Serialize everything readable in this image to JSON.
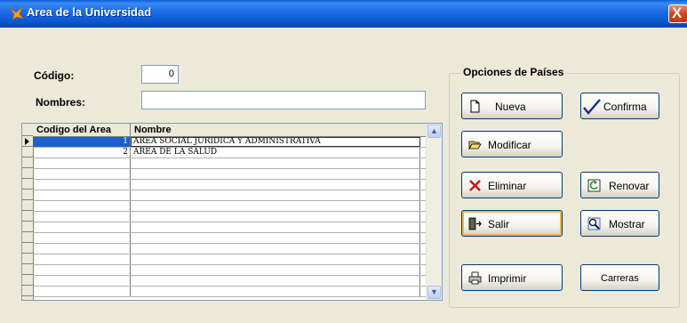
{
  "window": {
    "title": "Area de la Universidad",
    "close_glyph": "X"
  },
  "form": {
    "codigo_label": "Código:",
    "codigo_value": "0",
    "nombres_label": "Nombres:",
    "nombres_value": ""
  },
  "grid": {
    "columns": [
      "Codigo del Area",
      "Nombre"
    ],
    "rows": [
      {
        "codigo": "1",
        "nombre": "AREA SOCIAL JURIDICA Y ADMINISTRATIVA"
      },
      {
        "codigo": "2",
        "nombre": "AREA DE LA SALUD"
      }
    ],
    "scroll_up_glyph": "▲",
    "scroll_down_glyph": "▼"
  },
  "options": {
    "title": "Opciones de Países",
    "nueva": "Nueva",
    "confirma": "Confirma",
    "modificar": "Modificar",
    "eliminar": "Eliminar",
    "renovar": "Renovar",
    "salir": "Salir",
    "mostrar": "Mostrar",
    "imprimir": "Imprimir",
    "carreras": "Carreras"
  },
  "icons": {
    "app": "fox-icon",
    "nueva": "new-document-icon",
    "confirma": "checkmark-icon",
    "modificar": "folder-open-icon",
    "eliminar": "delete-x-icon",
    "renovar": "refresh-icon",
    "salir": "exit-door-icon",
    "mostrar": "search-icon",
    "imprimir": "printer-icon"
  }
}
